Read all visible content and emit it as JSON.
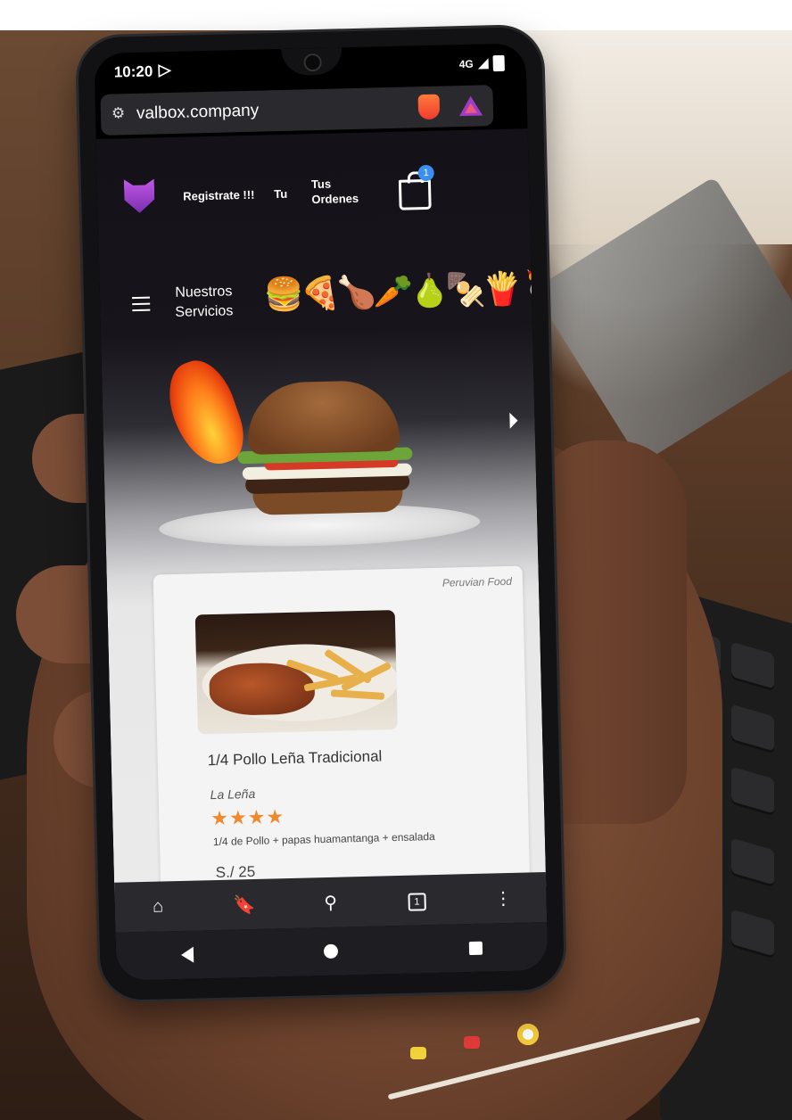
{
  "status_bar": {
    "time": "10:20",
    "network": "4G"
  },
  "browser": {
    "url": "valbox.company"
  },
  "site_header": {
    "register_label": "Registrate !!!",
    "tu_label": "Tu",
    "orders_label": "Tus Ordenes",
    "cart_count": "1"
  },
  "services_nav": {
    "label_line1": "Nuestros",
    "label_line2": "Servicios",
    "category_icons": [
      "burger-icon",
      "pizza-icon",
      "chicken-icon",
      "vegetables-icon",
      "fries-icon",
      "drinks-icon"
    ],
    "icons_text": "🍔🍕🍗🥕🍐🍢🍟🍹"
  },
  "product_card": {
    "tag": "Peruvian Food",
    "title": "1/4 Pollo Leña Tradicional",
    "restaurant": "La Leña",
    "rating": 4,
    "stars": "★★★★",
    "description": "1/4 de Pollo + papas huamantanga + ensalada",
    "price": "S./ 25"
  },
  "colors": {
    "star": "#f0892a",
    "badge": "#3a8ff0",
    "logo": "#b34fe0"
  }
}
